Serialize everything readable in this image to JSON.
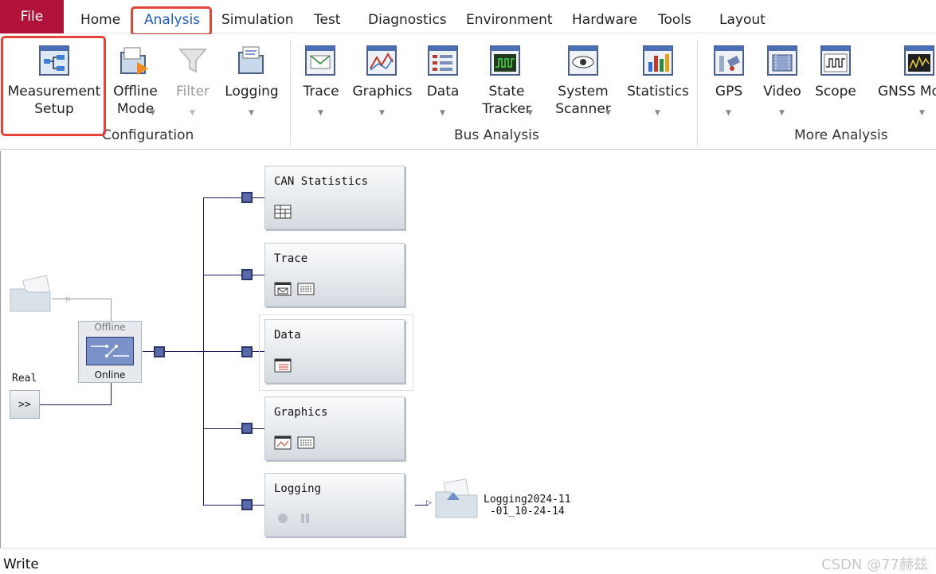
{
  "menubar": {
    "file_label": "File",
    "tabs": [
      {
        "label": "Home"
      },
      {
        "label": "Analysis",
        "active": true
      },
      {
        "label": "Simulation"
      },
      {
        "label": "Test"
      },
      {
        "label": "Diagnostics"
      },
      {
        "label": "Environment"
      },
      {
        "label": "Hardware"
      },
      {
        "label": "Tools"
      },
      {
        "label": "Layout"
      }
    ]
  },
  "ribbon": {
    "configuration": {
      "group_label": "Configuration",
      "buttons": [
        {
          "label": "Measurement\nSetup",
          "icon": "measurement-setup-icon"
        },
        {
          "label": "Offline\nMode",
          "icon": "offline-mode-icon"
        },
        {
          "label": "Filter",
          "icon": "filter-icon",
          "disabled": true
        },
        {
          "label": "Logging",
          "icon": "logging-icon"
        }
      ]
    },
    "bus_analysis": {
      "group_label": "Bus Analysis",
      "buttons": [
        {
          "label": "Trace",
          "icon": "trace-icon"
        },
        {
          "label": "Graphics",
          "icon": "graphics-icon"
        },
        {
          "label": "Data",
          "icon": "data-icon"
        },
        {
          "label": "State\nTracker",
          "icon": "state-tracker-icon"
        },
        {
          "label": "System\nScanner",
          "icon": "system-scanner-icon"
        },
        {
          "label": "Statistics",
          "icon": "statistics-icon"
        }
      ]
    },
    "more_analysis": {
      "group_label": "More Analysis",
      "buttons": [
        {
          "label": "GPS",
          "icon": "gps-icon"
        },
        {
          "label": "Video",
          "icon": "video-icon"
        },
        {
          "label": "Scope",
          "icon": "scope-icon"
        },
        {
          "label": "GNSS Mo",
          "icon": "gnss-monitor-icon"
        }
      ]
    }
  },
  "canvas": {
    "switch": {
      "top_label": "Offline",
      "bottom_label": "Online"
    },
    "real_label": "Real",
    "real_button": ">>",
    "blocks": [
      {
        "title": "CAN Statistics"
      },
      {
        "title": "Trace"
      },
      {
        "title": "Data"
      },
      {
        "title": "Graphics"
      },
      {
        "title": "Logging"
      }
    ],
    "logging_file": "Logging2024-11\n-01_10-24-14"
  },
  "status": {
    "text": "Write"
  },
  "watermark": "CSDN @77赫兹",
  "colors": {
    "file_tab": "#b0123a",
    "active_tab": "#1f5bc0",
    "highlight": "#e2443a",
    "node": "#5a6aa8"
  }
}
